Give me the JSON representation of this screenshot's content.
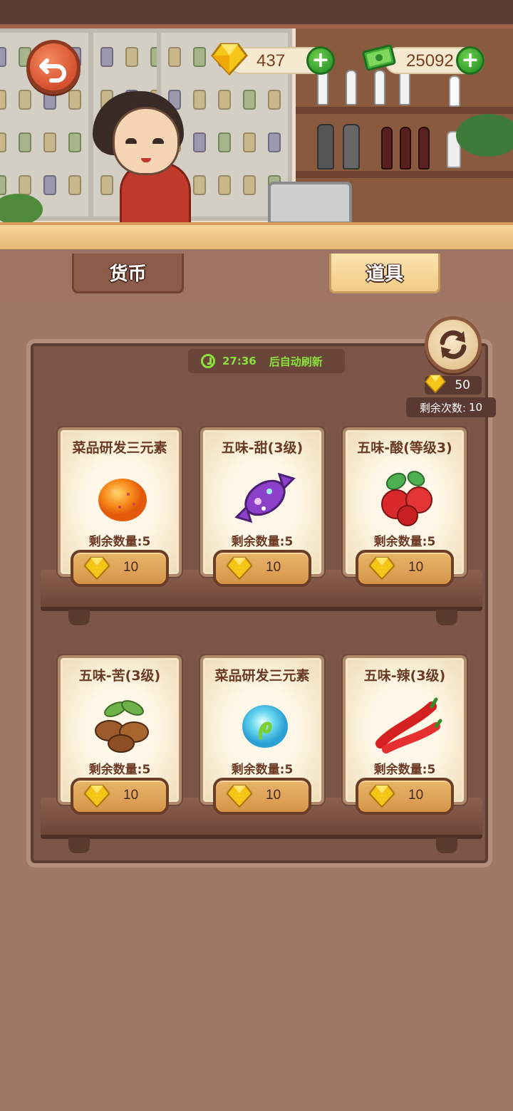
{
  "header": {
    "gems": "437",
    "cash": "25092",
    "plus_symbol": "+",
    "colors": {
      "plus": "#2f9a2a",
      "back": "#d4502e"
    }
  },
  "tabs": [
    {
      "label": "货币",
      "active": false
    },
    {
      "label": "道具",
      "active": true
    }
  ],
  "shop": {
    "timer_time": "27:36",
    "timer_text": "后自动刷新",
    "refresh_cost": "50",
    "remaining_label": "剩余次数:",
    "remaining_count": "10",
    "items": [
      {
        "name": "菜品研发三元素",
        "qty": "剩余数量:5",
        "price": "10",
        "icon": "orange-orb-icon"
      },
      {
        "name": "五味-甜(3级)",
        "qty": "剩余数量:5",
        "price": "10",
        "icon": "candy-icon"
      },
      {
        "name": "五味-酸(等级3)",
        "qty": "剩余数量:5",
        "price": "10",
        "icon": "hawthorn-icon"
      },
      {
        "name": "五味-苦(3级)",
        "qty": "剩余数量:5",
        "price": "10",
        "icon": "coffee-beans-icon"
      },
      {
        "name": "菜品研发三元素",
        "qty": "剩余数量:5",
        "price": "10",
        "icon": "blue-orb-icon"
      },
      {
        "name": "五味-辣(3级)",
        "qty": "剩余数量:5",
        "price": "10",
        "icon": "chili-icon"
      }
    ]
  }
}
